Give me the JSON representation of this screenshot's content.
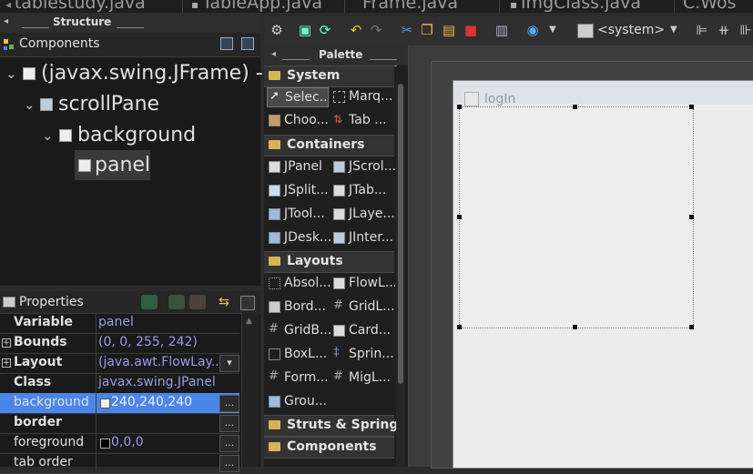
{
  "editor_tabs": [
    {
      "label": "tablestudy.java"
    },
    {
      "label": "TableApp.java"
    },
    {
      "label": "Frame.java"
    },
    {
      "label": "ImgClass.java"
    },
    {
      "label": "C.Wos"
    }
  ],
  "structure": {
    "title": "Structure",
    "components_label": "Components",
    "tree": [
      {
        "label": "(javax.swing.JFrame) - \"",
        "expanded": true
      },
      {
        "label": "scrollPane",
        "expanded": true
      },
      {
        "label": "background",
        "expanded": true
      },
      {
        "label": "panel",
        "selected": true
      }
    ]
  },
  "properties": {
    "title": "Properties",
    "rows": [
      {
        "name": "Variable",
        "value": "panel",
        "bold": true
      },
      {
        "name": "Bounds",
        "value": "(0, 0, 255, 242)",
        "bold": true,
        "expandable": true
      },
      {
        "name": "Layout",
        "value": "(java.awt.FlowLay...",
        "bold": true,
        "expandable": true,
        "button": "▾"
      },
      {
        "name": "Class",
        "value": "javax.swing.JPanel",
        "bold": true
      },
      {
        "name": "background",
        "value": "240,240,240",
        "bold": false,
        "selected": true,
        "button": "...",
        "swatch": "#f0f0f0"
      },
      {
        "name": "border",
        "value": "",
        "bold": true,
        "button": "..."
      },
      {
        "name": "foreground",
        "value": "0,0,0",
        "bold": false,
        "button": "...",
        "swatch": "#000000"
      },
      {
        "name": "tab order",
        "value": "",
        "bold": false,
        "button": "..."
      }
    ]
  },
  "toolbar": {
    "system_label": "<system>"
  },
  "palette": {
    "title": "Palette",
    "categories": [
      {
        "label": "System",
        "items": [
          {
            "label": "Selec...",
            "selected": true
          },
          {
            "label": "Marq..."
          },
          {
            "label": "Choo..."
          },
          {
            "label": "Tab ..."
          }
        ]
      },
      {
        "label": "Containers",
        "items": [
          {
            "label": "JPanel"
          },
          {
            "label": "JScrol..."
          },
          {
            "label": "JSplit..."
          },
          {
            "label": "JTab..."
          },
          {
            "label": "JTool..."
          },
          {
            "label": "JLaye..."
          },
          {
            "label": "JDesk..."
          },
          {
            "label": "JInter..."
          }
        ]
      },
      {
        "label": "Layouts",
        "items": [
          {
            "label": "Absol..."
          },
          {
            "label": "FlowL..."
          },
          {
            "label": "Bord..."
          },
          {
            "label": "GridL..."
          },
          {
            "label": "GridB..."
          },
          {
            "label": "Card..."
          },
          {
            "label": "BoxL..."
          },
          {
            "label": "Sprin..."
          },
          {
            "label": "Form..."
          },
          {
            "label": "MigL..."
          },
          {
            "label": "Grou..."
          }
        ]
      },
      {
        "label": "Struts & Springs",
        "items": []
      },
      {
        "label": "Components",
        "items": []
      }
    ]
  },
  "canvas": {
    "frame_title": "logIn"
  },
  "colors": {
    "accent_selection": "#4a86e8",
    "prop_value": "#9a9ae8"
  }
}
